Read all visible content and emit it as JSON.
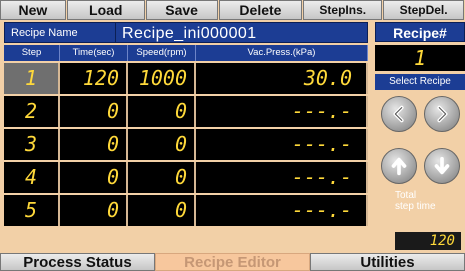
{
  "toolbar": {
    "new": "New",
    "load": "Load",
    "save": "Save",
    "delete": "Delete",
    "step_ins": "StepIns.",
    "step_del": "StepDel."
  },
  "recipe_name": {
    "label": "Recipe Name",
    "value": "Recipe_ini000001"
  },
  "table": {
    "headers": {
      "step": "Step",
      "time": "Time(sec)",
      "speed": "Speed(rpm)",
      "vac": "Vac.Press.(kPa)"
    },
    "rows": [
      {
        "step": "1",
        "time": "120",
        "speed": "1000",
        "vac": "30.0"
      },
      {
        "step": "2",
        "time": "0",
        "speed": "0",
        "vac": "---.-"
      },
      {
        "step": "3",
        "time": "0",
        "speed": "0",
        "vac": "---.-"
      },
      {
        "step": "4",
        "time": "0",
        "speed": "0",
        "vac": "---.-"
      },
      {
        "step": "5",
        "time": "0",
        "speed": "0",
        "vac": "---.-"
      }
    ],
    "selected_step": "1"
  },
  "right_panel": {
    "recipe_no_label": "Recipe#",
    "recipe_no_value": "1",
    "select_recipe_label": "Select Recipe",
    "total_label_line1": "Total",
    "total_label_line2": "step time",
    "total_value": "120"
  },
  "icons": {
    "left": "arrow-left-icon",
    "right": "arrow-right-icon",
    "up": "arrow-up-icon",
    "down": "arrow-down-icon"
  },
  "tabs": {
    "process_status": "Process Status",
    "recipe_editor": "Recipe Editor",
    "utilities": "Utilities",
    "active": "Recipe Editor"
  },
  "colors": {
    "header_blue": "#1c3d94",
    "digit_yellow": "#ffd93a",
    "panel_bg": "#f2d0a7",
    "active_tab": "#f7c79d"
  }
}
